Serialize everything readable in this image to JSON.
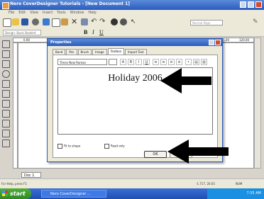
{
  "window": {
    "title": "Nero CoverDesigner Tutorials - [New Document 1]",
    "menu": [
      "File",
      "Edit",
      "View",
      "Insert",
      "Tools",
      "Window",
      "Help"
    ],
    "toolbar_combo": "Normal Page",
    "toolbar2_combo": "Design: Basic Booklet"
  },
  "ruler": {
    "left": "0.00",
    "right_a": "105.00",
    "right_b": "120.00"
  },
  "dialog": {
    "title": "Properties",
    "tabs": [
      "Band",
      "Pen",
      "Brush",
      "Image",
      "Textbox",
      "Import Text"
    ],
    "active_tab": "Textbox",
    "font": "Times New Roman",
    "text_content": "Holiday 2006",
    "checkbox_fit": "Fit to shape",
    "checkbox_readonly": "Read only",
    "ok_label": "OK"
  },
  "document_tab": "Doc 1",
  "statusbar": {
    "help": "For Help, press F1",
    "coords": "-1.717, 20.05",
    "mode": "NUM"
  },
  "taskbar": {
    "start": "start",
    "item": "Nero CoverDesigner ...",
    "clock": "7:35 AM"
  },
  "colors": {
    "titlebar": "#2a5bbd",
    "taskbar": "#1f4fb0",
    "start": "#2f8a23",
    "arrow": "#000000"
  }
}
